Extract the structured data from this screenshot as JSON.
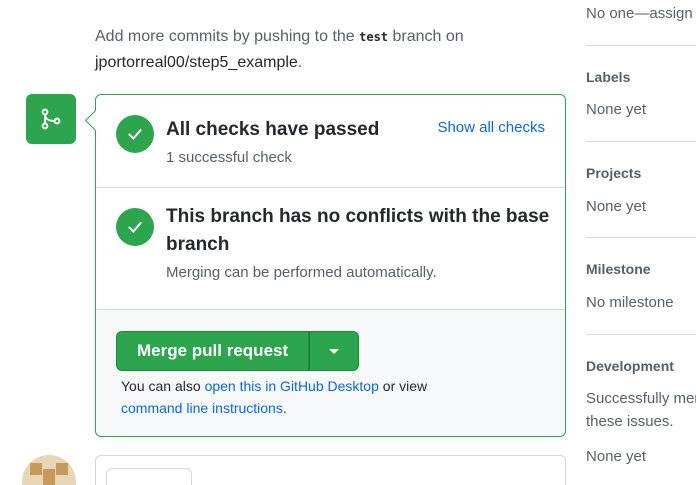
{
  "push_note": {
    "prefix": "Add more commits by pushing to the ",
    "branch": "test",
    "middle": " branch on",
    "repo": "jportorreal00/step5_example",
    "suffix": "."
  },
  "checks": {
    "title": "All checks have passed",
    "subtitle": "1 successful check",
    "show_all_link": "Show all checks"
  },
  "conflicts": {
    "title": "This branch has no conflicts with the base branch",
    "subtitle": "Merging can be performed automatically."
  },
  "merge": {
    "button_label": "Merge pull request",
    "also_prefix": "You can also ",
    "desktop_link": "open this in GitHub Desktop",
    "also_middle": " or view",
    "cli_link": "command line instructions",
    "also_suffix": "."
  },
  "sidebar": {
    "assignees_value": "No one—assign",
    "labels": {
      "heading": "Labels",
      "value": "None yet"
    },
    "projects": {
      "heading": "Projects",
      "value": "None yet"
    },
    "milestone": {
      "heading": "Milestone",
      "value": "No milestone"
    },
    "development": {
      "heading": "Development",
      "line1": "Successfully merg",
      "line2": "these issues.",
      "value": "None yet"
    }
  },
  "colors": {
    "success": "#2da44e",
    "link": "#0969da",
    "border": "#d0d7de"
  },
  "icons": {
    "merge": "git-merge-icon",
    "check": "check-icon",
    "caret": "triangle-down-icon"
  }
}
